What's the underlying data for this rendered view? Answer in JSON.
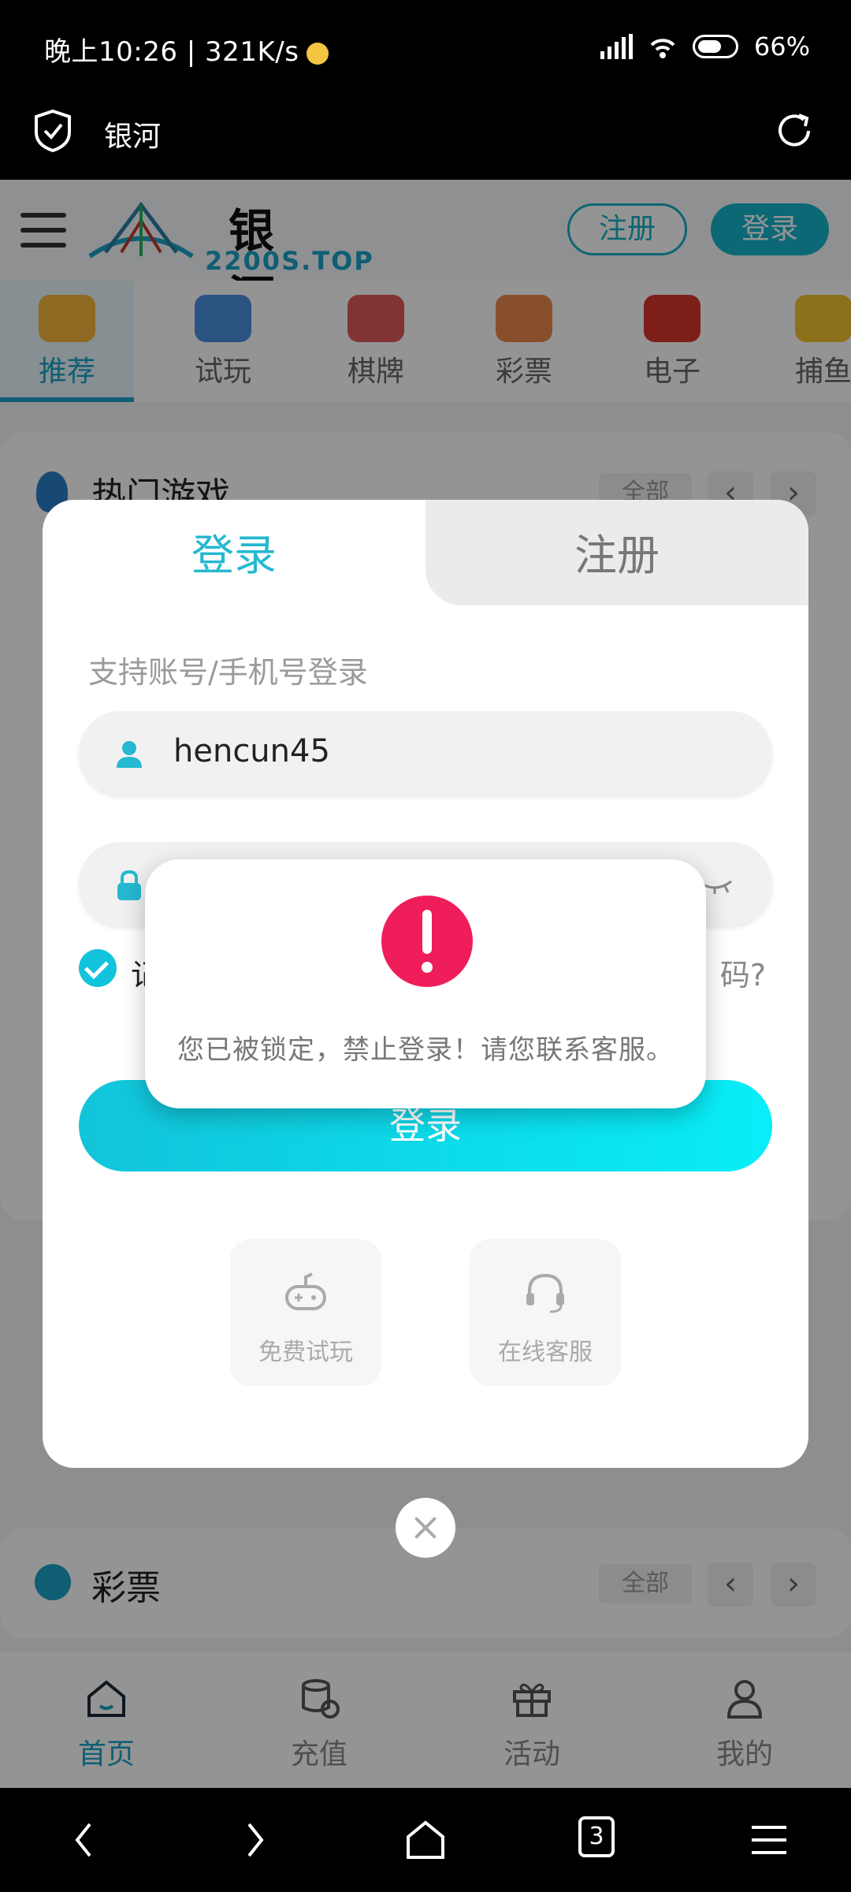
{
  "status_bar": {
    "time": "晚上10:26 | 321K/s",
    "battery": "66%"
  },
  "browser": {
    "title": "银河"
  },
  "site": {
    "logo_cn": "银 河",
    "logo_en": "2200S.TOP",
    "register_label": "注册",
    "login_label": "登录",
    "categories": [
      {
        "label": "推荐",
        "icon": "thumbs-up-icon"
      },
      {
        "label": "试玩",
        "icon": "gamepad-icon"
      },
      {
        "label": "棋牌",
        "icon": "cards-icon"
      },
      {
        "label": "彩票",
        "icon": "lottery-balls-icon"
      },
      {
        "label": "电子",
        "icon": "slot-777-icon"
      },
      {
        "label": "捕鱼",
        "icon": "fish-icon"
      }
    ],
    "sections": [
      {
        "title": "热门游戏",
        "all_label": "全部"
      },
      {
        "title": "彩票",
        "all_label": "全部"
      }
    ],
    "bottom_tabs": [
      {
        "label": "首页",
        "icon": "home-icon"
      },
      {
        "label": "充值",
        "icon": "coins-icon"
      },
      {
        "label": "活动",
        "icon": "gift-icon"
      },
      {
        "label": "我的",
        "icon": "user-icon"
      }
    ]
  },
  "modal": {
    "tab_login": "登录",
    "tab_register": "注册",
    "hint": "支持账号/手机号登录",
    "username_value": "hencun45",
    "remember_label": "记",
    "forgot_label": "码?",
    "submit_label": "登录",
    "quick_actions": [
      {
        "label": "免费试玩",
        "icon": "gamepad-icon"
      },
      {
        "label": "在线客服",
        "icon": "headset-icon"
      }
    ]
  },
  "alert": {
    "message": "您已被锁定，禁止登录！请您联系客服。",
    "icon": "exclamation-icon",
    "color": "#f01d5b"
  },
  "nav": {
    "tab_count": "3"
  },
  "colors": {
    "accent": "#1aa3c8",
    "button_gradient_start": "#12c4da",
    "button_gradient_end": "#08eef8"
  }
}
